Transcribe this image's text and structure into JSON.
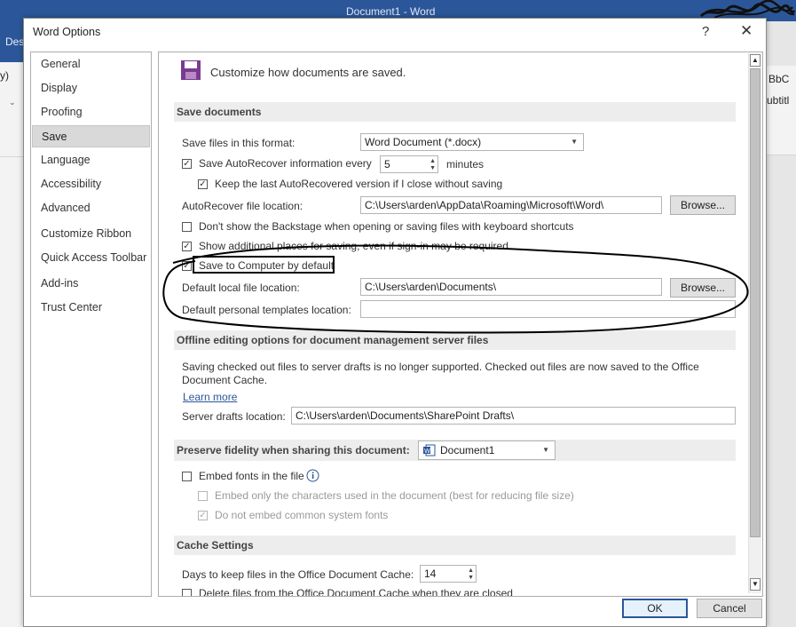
{
  "word": {
    "window_title": "Document1  -  Word",
    "tab_fragment": "Des",
    "left_fragment": "y)",
    "right_fragment_top": "BbC",
    "right_fragment_bottom": "ubtitl"
  },
  "dialog": {
    "title": "Word Options",
    "help_glyph": "?",
    "close_glyph": "✕",
    "ok_label": "OK",
    "cancel_label": "Cancel"
  },
  "nav": {
    "items": [
      "General",
      "Display",
      "Proofing",
      "Save",
      "Language",
      "Accessibility",
      "Advanced",
      "Customize Ribbon",
      "Quick Access Toolbar",
      "Add-ins",
      "Trust Center"
    ],
    "selected": "Save"
  },
  "content": {
    "header_text": "Customize how documents are saved.",
    "save_documents": {
      "title": "Save documents",
      "format_label": "Save files in this format:",
      "format_value": "Word Document (*.docx)",
      "autorecover_label": "Save AutoRecover information every",
      "autorecover_minutes": "5",
      "minutes_label": "minutes",
      "keep_last_label": "Keep the last AutoRecovered version if I close without saving",
      "autorecover_location_label": "AutoRecover file location:",
      "autorecover_location_value": "C:\\Users\\arden\\AppData\\Roaming\\Microsoft\\Word\\",
      "browse_label": "Browse...",
      "backstage_label": "Don't show the Backstage when opening or saving files with keyboard shortcuts",
      "additional_places_label": "Show additional places for saving, even if sign-in may be required.",
      "save_to_computer_label": "Save to Computer by default",
      "default_local_label": "Default local file location:",
      "default_local_value": "C:\\Users\\arden\\Documents\\",
      "browse2_label": "Browse...",
      "templates_label": "Default personal templates location:",
      "templates_value": ""
    },
    "offline": {
      "title": "Offline editing options for document management server files",
      "note": "Saving checked out files to server drafts is no longer supported. Checked out files are now saved to the Office",
      "note2": "Document Cache.",
      "learn_more": "Learn more",
      "drafts_label": "Server drafts location:",
      "drafts_value": "C:\\Users\\arden\\Documents\\SharePoint Drafts\\"
    },
    "fidelity": {
      "title": "Preserve fidelity when sharing this document:",
      "document_value": "Document1",
      "embed_fonts_label": "Embed fonts in the file",
      "embed_only_label": "Embed only the characters used in the document (best for reducing file size)",
      "no_common_label": "Do not embed common system fonts"
    },
    "cache": {
      "title": "Cache Settings",
      "days_label": "Days to keep files in the Office Document Cache:",
      "days_value": "14",
      "delete_label": "Delete files from the Office Document Cache when they are closed"
    }
  },
  "colors": {
    "accent": "#2b579a",
    "section_bg": "#ededed"
  }
}
